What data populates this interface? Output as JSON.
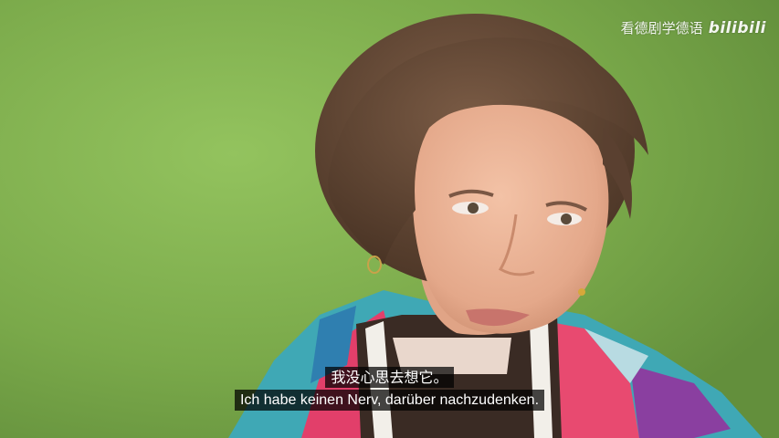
{
  "video": {
    "watermark": {
      "channel": "看德剧学德语",
      "logo": "bilibili"
    },
    "subtitles": {
      "chinese": "我没心思去想它。",
      "german": "Ich habe keinen Nerv, darüber nachzudenken."
    }
  }
}
